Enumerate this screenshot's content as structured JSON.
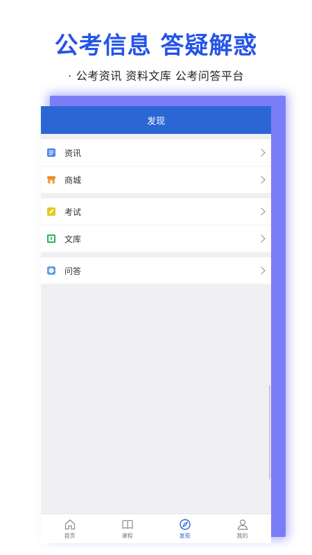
{
  "promo": {
    "title": "公考信息 答疑解惑",
    "subtitle": "公考资讯 资料文库 公考问答平台",
    "bullet": "·"
  },
  "header": {
    "title": "发现"
  },
  "menu_groups": [
    {
      "items": [
        {
          "label": "资讯",
          "icon": "news-icon"
        },
        {
          "label": "商城",
          "icon": "shop-icon"
        }
      ]
    },
    {
      "items": [
        {
          "label": "考试",
          "icon": "exam-icon"
        },
        {
          "label": "文库",
          "icon": "library-icon"
        }
      ]
    },
    {
      "items": [
        {
          "label": "问答",
          "icon": "qa-icon"
        }
      ]
    }
  ],
  "tabbar": {
    "items": [
      {
        "label": "首页",
        "icon": "home-icon"
      },
      {
        "label": "课程",
        "icon": "book-icon"
      },
      {
        "label": "发现",
        "icon": "compass-icon",
        "active": true
      },
      {
        "label": "我的",
        "icon": "user-icon"
      }
    ]
  },
  "colors": {
    "brand_blue": "#2554e8",
    "header_blue": "#2a67d5",
    "frame_purple": "#7b7cf7"
  }
}
